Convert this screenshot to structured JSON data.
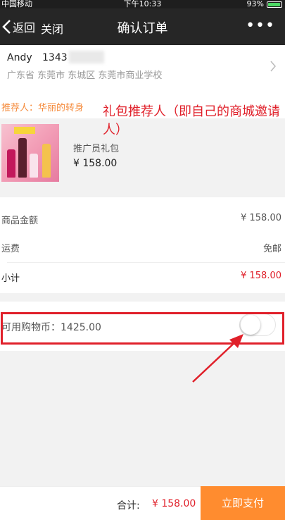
{
  "status_bar": {
    "carrier": "中国移动",
    "time": "下午10:33",
    "battery_percent": "93%"
  },
  "nav": {
    "back_label": "返回",
    "close_label": "关闭",
    "title": "确认订单",
    "more_label": "•••"
  },
  "address": {
    "name": "Andy",
    "phone": "1343",
    "detail": "广东省 东莞市 东城区 东莞市商业学校"
  },
  "recommender": {
    "label": "推荐人：华丽的转身"
  },
  "annotation": {
    "text": "礼包推荐人（即自己的商城邀请人）"
  },
  "product": {
    "name": "推广员礼包",
    "price": "¥ 158.00"
  },
  "summary": {
    "goods_amount_label": "商品金额",
    "goods_amount_value": "¥ 158.00",
    "shipping_label": "运费",
    "shipping_value": "免邮",
    "subtotal_label": "小计",
    "subtotal_value": "¥ 158.00"
  },
  "coins": {
    "label": "可用购物币：1425.00",
    "toggle_on": false
  },
  "footer": {
    "total_label": "合计:",
    "total_value": "¥ 158.00",
    "pay_button_label": "立即支付"
  },
  "colors": {
    "nav_bg": "#262626",
    "accent_orange": "#ff8c2f",
    "price_red": "#e0202a",
    "recommender_orange": "#f58b3c"
  }
}
